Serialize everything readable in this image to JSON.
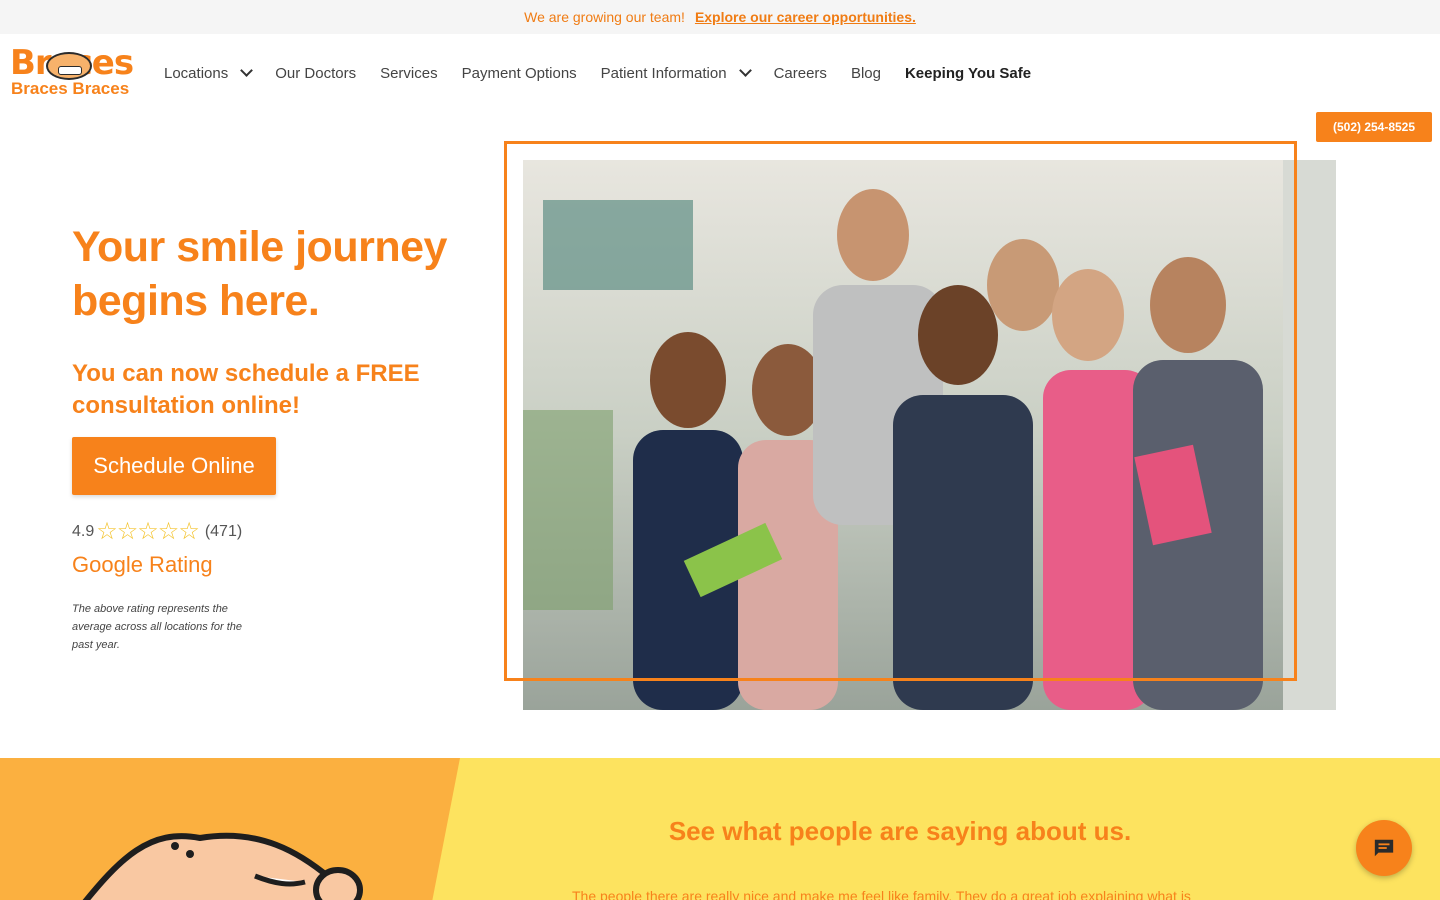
{
  "announcement": {
    "message": "We are growing our team!",
    "link": "Explore our career opportunities."
  },
  "logo": {
    "line1": "Braces",
    "line2": "Braces Braces"
  },
  "nav": {
    "items": [
      {
        "label": "Locations",
        "dropdown": true
      },
      {
        "label": "Our Doctors"
      },
      {
        "label": "Services"
      },
      {
        "label": "Payment Options"
      },
      {
        "label": "Patient Information",
        "dropdown": true
      },
      {
        "label": "Careers"
      },
      {
        "label": "Blog"
      },
      {
        "label": "Keeping You Safe",
        "bold": true
      }
    ]
  },
  "phone": "(502) 254-8525",
  "hero": {
    "title_line1": "Your smile journey",
    "title_line2": "begins here.",
    "subtitle": "You can now schedule a FREE consultation online!",
    "cta": "Schedule Online",
    "rating_value": "4.9",
    "rating_count": "(471)",
    "rating_stars": 5,
    "rating_label": "Google Rating",
    "disclaimer": "The above rating represents the average across all locations for the past year."
  },
  "testimonials": {
    "title": "See what people are saying about us.",
    "text": "The people there are really nice and make me feel like family. They do a great job explaining what is"
  },
  "colors": {
    "brand_orange": "#f7821b",
    "yellow": "#fde35f",
    "light_orange": "#fbb040"
  },
  "icons": {
    "chat": "chat-bubble-icon",
    "chevron": "chevron-down-icon",
    "star": "star-outline-icon"
  }
}
